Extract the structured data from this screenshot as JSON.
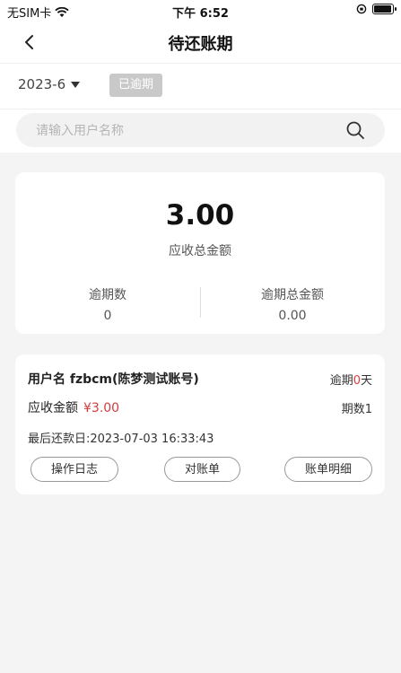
{
  "status_bar": {
    "carrier": "无SIM卡",
    "time": "下午 6:52"
  },
  "nav": {
    "title": "待还账期"
  },
  "filter": {
    "month": "2023-6",
    "overdue_tag": "已逾期"
  },
  "search": {
    "placeholder": "请输入用户名称",
    "value": ""
  },
  "summary": {
    "total_amount": "3.00",
    "total_label": "应收总金额",
    "overdue_count_label": "逾期数",
    "overdue_count": "0",
    "overdue_total_label": "逾期总金额",
    "overdue_total": "0.00"
  },
  "record": {
    "user_label": "用户名",
    "user_name": "fzbcm(陈梦测试账号)",
    "overdue_prefix": "逾期",
    "overdue_days": "0",
    "overdue_suffix": "天",
    "amount_label": "应收金额",
    "amount": "¥3.00",
    "periods": "期数1",
    "last_payment": "最后还款日:2023-07-03 16:33:43",
    "buttons": {
      "log": "操作日志",
      "reconcile": "对账单",
      "detail": "账单明细"
    }
  }
}
